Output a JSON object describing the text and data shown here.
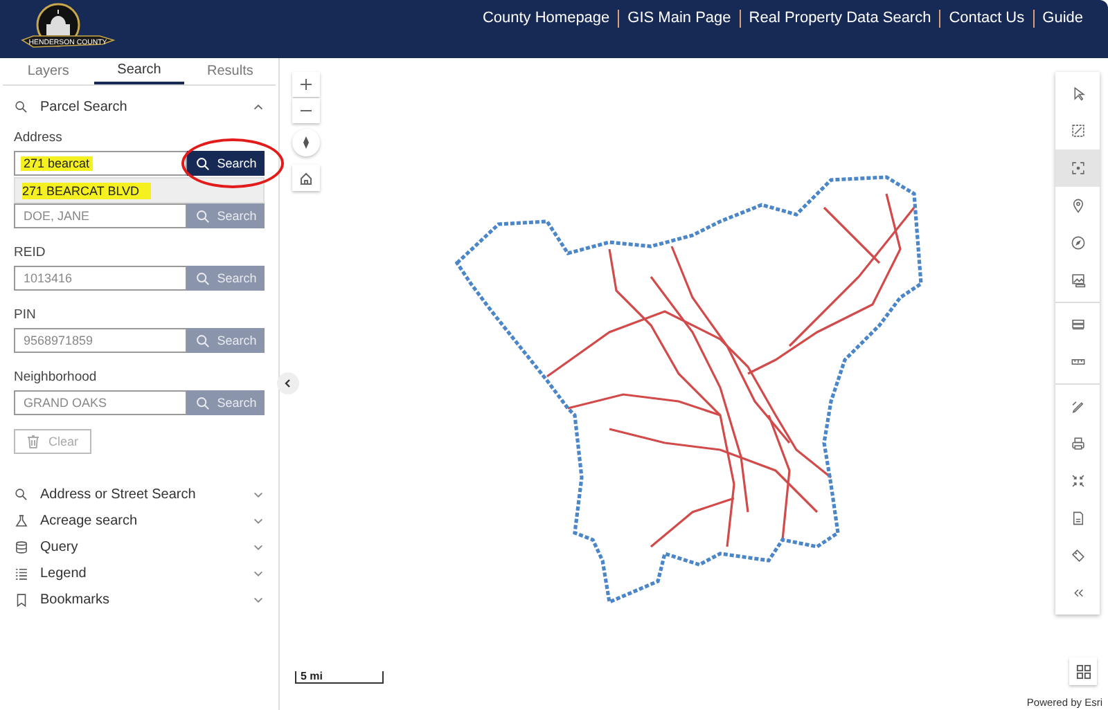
{
  "header": {
    "logo_text": "HENDERSON COUNTY",
    "links": [
      "County Homepage",
      "GIS Main Page",
      "Real Property Data Search",
      "Contact Us",
      "Guide"
    ]
  },
  "tabs": [
    {
      "label": "Layers",
      "selected": false
    },
    {
      "label": "Search",
      "selected": true
    },
    {
      "label": "Results",
      "selected": false
    }
  ],
  "parcel_search": {
    "title": "Parcel Search",
    "expanded": true,
    "fields": [
      {
        "label": "Address",
        "value": "271 bearcat",
        "highlighted": true,
        "button": "Search",
        "disabled": false,
        "suggestion": "271 BEARCAT BLVD"
      },
      {
        "placeholder": "DOE, JANE",
        "highlighted": false,
        "button": "Search",
        "disabled": true
      },
      {
        "label": "REID",
        "placeholder": "1013416",
        "highlighted": false,
        "button": "Search",
        "disabled": true
      },
      {
        "label": "PIN",
        "placeholder": "9568971859",
        "highlighted": false,
        "button": "Search",
        "disabled": true
      },
      {
        "label": "Neighborhood",
        "placeholder": "GRAND OAKS",
        "highlighted": false,
        "button": "Search",
        "disabled": true
      }
    ],
    "clear_button": {
      "label": "Clear",
      "disabled": true
    }
  },
  "accordion": [
    {
      "label": "Address or Street Search",
      "expanded": false
    },
    {
      "label": "Acreage search",
      "expanded": false
    },
    {
      "label": "Query",
      "expanded": false
    },
    {
      "label": "Legend",
      "expanded": false
    },
    {
      "label": "Bookmarks",
      "expanded": false
    }
  ],
  "toolbar": {
    "groups": [
      [
        {
          "selected": false
        },
        {
          "selected": false
        },
        {
          "selected": true
        },
        {
          "selected": false
        },
        {
          "selected": false
        },
        {
          "selected": false
        }
      ],
      [
        {
          "selected": false
        },
        {
          "selected": false
        }
      ],
      [
        {
          "selected": false
        },
        {
          "selected": false
        },
        {
          "selected": false
        },
        {
          "selected": false
        },
        {
          "selected": false
        },
        {
          "selected": false
        }
      ]
    ]
  },
  "map": {
    "scale": "5 mi",
    "attribution": "Powered by Esri"
  }
}
